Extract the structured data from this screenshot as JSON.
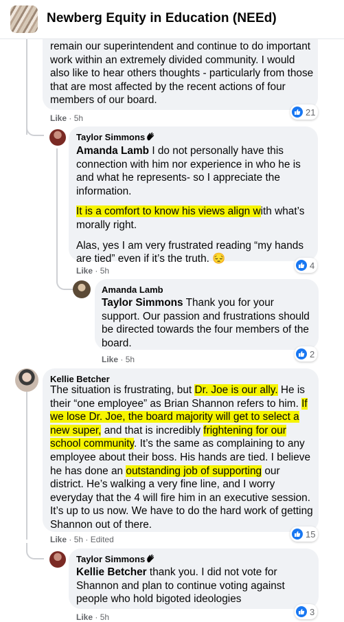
{
  "group": {
    "title": "Newberg Equity in Education (NEEd)"
  },
  "comments": [
    {
      "text": "remain our superintendent and continue to do important work within an extremely divided community. I would also like to hear others thoughts - particularly from those that are most affected by the recent actions of four members of our board.",
      "like_label": "Like",
      "time": "5h",
      "reactions": "21"
    },
    {
      "author": "Taylor Simmons",
      "mention": "Amanda Lamb",
      "p1": " I do not personally have this connection with him nor experience in who he is and what he represents- so I appreciate the information.",
      "p2_highlight": "It is a comfort to know his views align w",
      "p2_rest": "ith what’s morally right.",
      "p3": "Alas, yes I am very frustrated reading “my hands are tied” even if it’s the truth. 😔",
      "like_label": "Like",
      "time": "5h",
      "reactions": "4"
    },
    {
      "author": "Amanda Lamb",
      "mention": "Taylor Simmons",
      "text": " Thank you for your support. Our passion and frustrations should be directed towards the four members of the board.",
      "like_label": "Like",
      "time": "5h",
      "reactions": "2"
    },
    {
      "author": "Kellie Betcher",
      "t1": "The situation is frustrating, but ",
      "h1": "Dr. Joe is our ally.",
      "t2": " He is their “one employee” as Brian Shannon refers to him. ",
      "h2": "If we lose Dr. Joe, the board majority will get to select a new super,",
      "t3": " and that is incredibly ",
      "h3": "frightening for our school community",
      "t4": ". It’s the same as complaining to any employee about their boss. His hands are tied. I believe he has done an ",
      "h4": "outstanding job of supporting",
      "t5": " our district. He’s walking a very fine line, and I worry everyday that the 4 will fire him in an executive session. It’s up to us now. We have to do the hard work of getting Shannon out of there.",
      "like_label": "Like",
      "time": "5h",
      "edited": "Edited",
      "reactions": "15"
    },
    {
      "author": "Taylor Simmons",
      "mention": "Kellie Betcher",
      "text": " thank you. I did not vote for Shannon and plan to continue voting against people who hold bigoted ideologies",
      "like_label": "Like",
      "time": "5h",
      "reactions": "3"
    }
  ],
  "colors": {
    "bubble": "#f0f2f5",
    "like_blue": "#1877f2",
    "highlight": "#f6f400",
    "meta": "#65676b"
  },
  "icons": {
    "like": "thumbs-up-icon",
    "wave": "waving-hand-icon"
  }
}
